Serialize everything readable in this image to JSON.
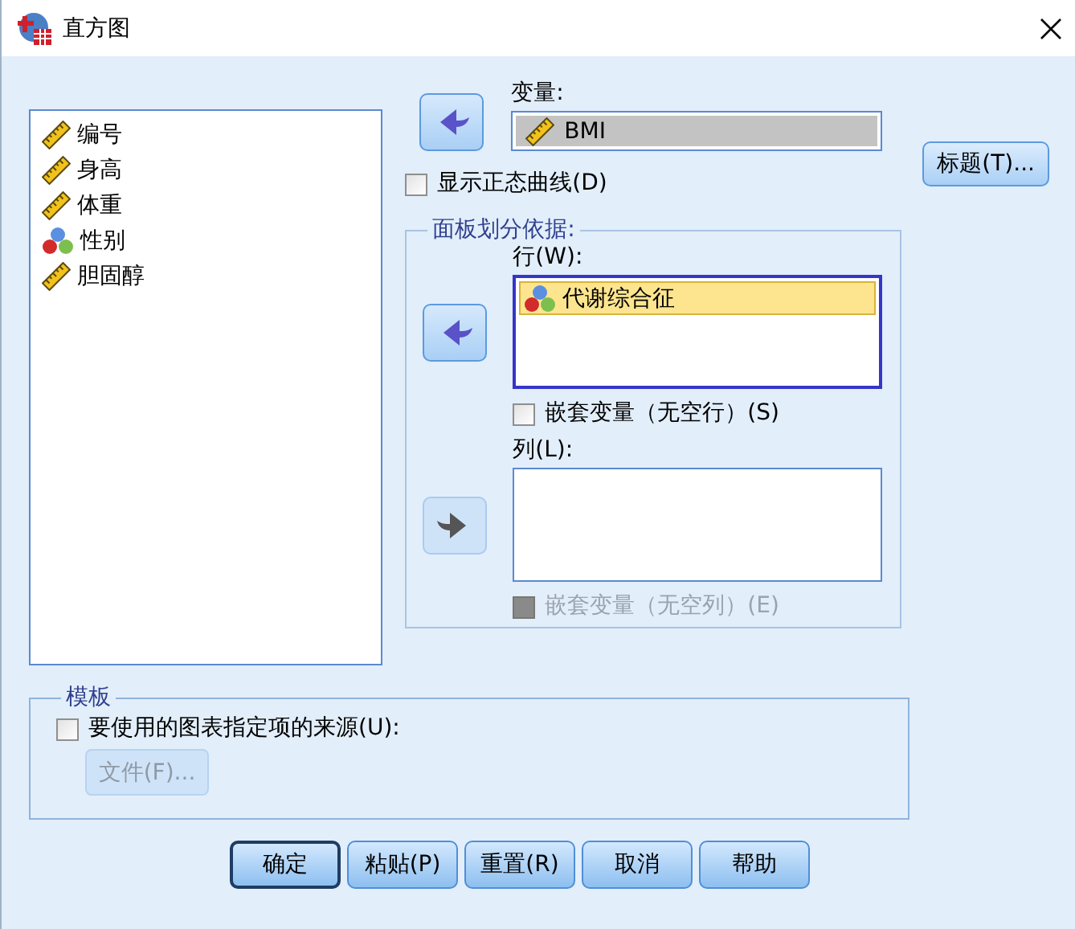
{
  "window": {
    "title": "直方图"
  },
  "variables": [
    {
      "name": "编号",
      "kind": "scale"
    },
    {
      "name": "身高",
      "kind": "scale"
    },
    {
      "name": "体重",
      "kind": "scale"
    },
    {
      "name": "性别",
      "kind": "nominal"
    },
    {
      "name": "胆固醇",
      "kind": "scale"
    }
  ],
  "variable_move": {
    "kind": "in",
    "disabled": false
  },
  "variable_field": {
    "label": "变量:",
    "value": {
      "name": "BMI",
      "kind": "scale"
    }
  },
  "normal_curve": {
    "label": "显示正态曲线(D)",
    "checked": false
  },
  "titles_button": {
    "label": "标题(T)..."
  },
  "panels": {
    "title": "面板划分依据:",
    "rows": {
      "label": "行(W):",
      "move": {
        "kind": "in",
        "disabled": false
      },
      "items": [
        {
          "name": "代谢综合征",
          "kind": "nominal",
          "selected": true
        }
      ]
    },
    "nest_rows": {
      "label": "嵌套变量（无空行）(S)",
      "checked": false,
      "disabled": false
    },
    "columns": {
      "label": "列(L):",
      "move": {
        "kind": "out",
        "disabled": true
      }
    },
    "nest_columns": {
      "label": "嵌套变量（无空列）(E)",
      "checked": false,
      "disabled": true
    }
  },
  "template": {
    "title": "模板",
    "checkbox": {
      "label": "要使用的图表指定项的来源(U):",
      "checked": false
    },
    "file_button": {
      "label": "文件(F)...",
      "disabled": true
    }
  },
  "buttons": [
    {
      "label": "确定",
      "default": true
    },
    {
      "label": "粘贴(P)",
      "default": false
    },
    {
      "label": "重置(R)",
      "default": false
    },
    {
      "label": "取消",
      "default": false
    },
    {
      "label": "帮助",
      "default": false
    }
  ]
}
